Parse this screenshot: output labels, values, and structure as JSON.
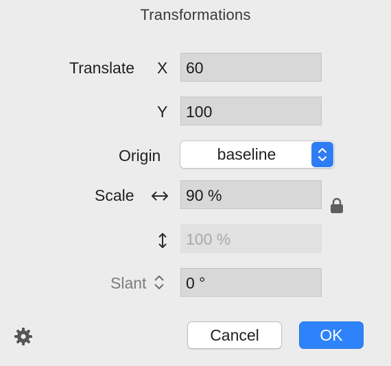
{
  "dialog": {
    "title": "Transformations"
  },
  "translate": {
    "label": "Translate",
    "x_label": "X",
    "x_value": "60",
    "y_label": "Y",
    "y_value": "100"
  },
  "origin": {
    "label": "Origin",
    "selected": "baseline"
  },
  "scale": {
    "label": "Scale",
    "horizontal_value": "90 %",
    "vertical_value": "100 %",
    "horizontal_icon": "horizontal-arrows-icon",
    "vertical_icon": "vertical-arrows-icon",
    "lock_icon": "lock-icon",
    "vertical_enabled": false
  },
  "slant": {
    "label": "Slant",
    "value": "0 °",
    "icon": "up-down-chevron-icon"
  },
  "footer": {
    "settings_icon": "gear-icon",
    "cancel_label": "Cancel",
    "ok_label": "OK"
  },
  "colors": {
    "accent": "#2f83fa",
    "background": "#ececec",
    "field": "#d8d8d8"
  }
}
